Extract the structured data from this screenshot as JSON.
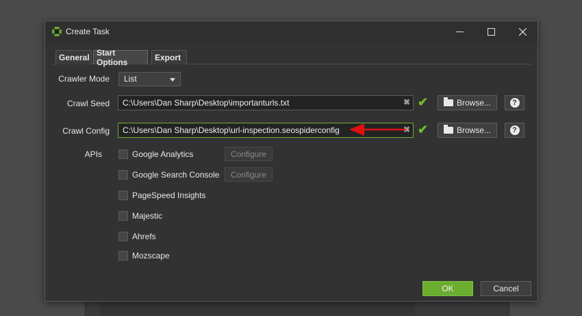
{
  "window": {
    "title": "Create Task",
    "controls": {
      "minimize": "—",
      "maximize": "☐",
      "close": "✕"
    }
  },
  "tabs": [
    {
      "label": "General"
    },
    {
      "label": "Start Options"
    },
    {
      "label": "Export"
    }
  ],
  "form": {
    "crawler_mode": {
      "label": "Crawler Mode",
      "value": "List"
    },
    "crawl_seed": {
      "label": "Crawl Seed",
      "value": "C:\\Users\\Dan Sharp\\Desktop\\importanturls.txt"
    },
    "crawl_config": {
      "label": "Crawl Config",
      "value": "C:\\Users\\Dan Sharp\\Desktop\\url-inspection.seospiderconfig"
    },
    "browse_label": "Browse...",
    "help_label": "?",
    "clear_label": "✖",
    "valid_mark": "✔"
  },
  "apis": {
    "label": "APIs",
    "items": [
      {
        "label": "Google Analytics",
        "configure": "Configure"
      },
      {
        "label": "Google Search Console",
        "configure": "Configure"
      },
      {
        "label": "PageSpeed Insights"
      },
      {
        "label": "Majestic"
      },
      {
        "label": "Ahrefs"
      },
      {
        "label": "Mozscape"
      }
    ]
  },
  "footer": {
    "ok": "OK",
    "cancel": "Cancel"
  },
  "colors": {
    "accent_green": "#6aad2f",
    "annotation_red": "#e01010"
  }
}
